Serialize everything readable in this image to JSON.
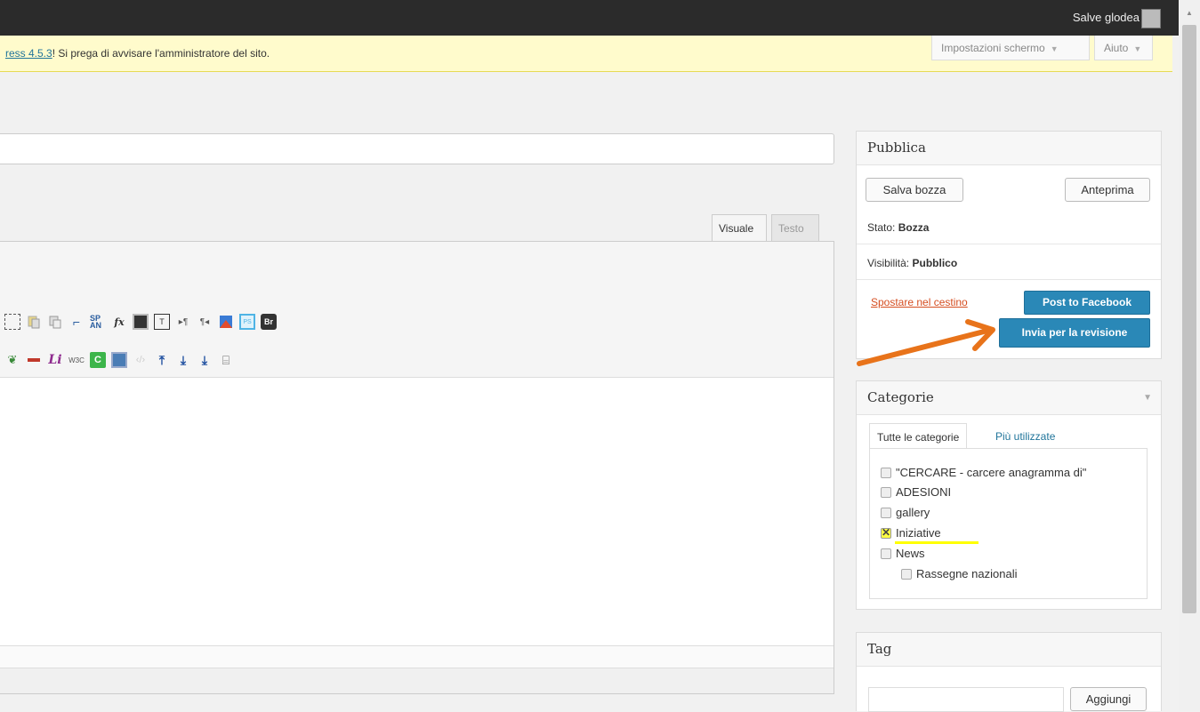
{
  "topbar": {
    "greeting": "Salve glodea"
  },
  "notice": {
    "link_text": "ress 4.5.3",
    "message": "! Si prega di avvisare l'amministratore del sito."
  },
  "screen_tabs": {
    "screen_options": "Impostazioni schermo",
    "help": "Aiuto"
  },
  "editor": {
    "tabs": {
      "visual": "Visuale",
      "text": "Testo"
    }
  },
  "toolbar": {
    "row1": [
      "select-icon",
      "paste-icon",
      "copy-icon",
      "crop-icon",
      "span-icon",
      "formula-icon",
      "qr-icon",
      "textbox-icon",
      "ltr-icon",
      "rtl-icon",
      "image-icon",
      "ps-icon",
      "br-icon"
    ],
    "row2": [
      "link-icon",
      "hr-icon",
      "li-icon",
      "w3c-icon",
      "c-icon",
      "map-icon",
      "code-icon",
      "insert-above-icon",
      "insert-below-icon",
      "insert-table-icon",
      "break-icon"
    ],
    "span_text": "SP AN",
    "formula_text": "fx",
    "br_text": "Br",
    "w3c_text": "W3C",
    "li_text": "Li",
    "c_text": "C"
  },
  "publish": {
    "title": "Pubblica",
    "save_draft": "Salva bozza",
    "preview": "Anteprima",
    "status_label": "Stato:",
    "status_value": "Bozza",
    "visibility_label": "Visibilità:",
    "visibility_value": "Pubblico",
    "trash": "Spostare nel cestino",
    "post_facebook": "Post to Facebook",
    "submit_review": "Invia per la revisione"
  },
  "categories": {
    "title": "Categorie",
    "tab_all": "Tutte le categorie",
    "tab_most_used": "Più utilizzate",
    "items": [
      {
        "label": "\"CERCARE - carcere anagramma di\"",
        "checked": false
      },
      {
        "label": "ADESIONI",
        "checked": false
      },
      {
        "label": "gallery",
        "checked": false
      },
      {
        "label": "Iniziative",
        "checked": true
      },
      {
        "label": "News",
        "checked": false
      },
      {
        "label": "Rassegne nazionali",
        "checked": false
      }
    ]
  },
  "tags": {
    "title": "Tag",
    "add_button": "Aggiungi"
  },
  "colors": {
    "primary_button": "#2a88b7",
    "trash_link": "#d54e21",
    "annotation_arrow": "#e8731a",
    "highlight": "#ffff00"
  }
}
